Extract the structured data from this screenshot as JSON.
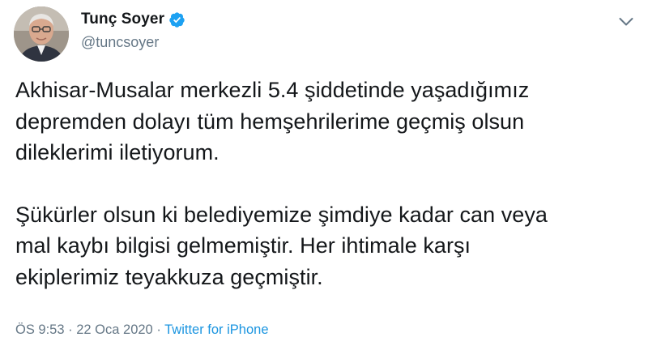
{
  "user": {
    "display_name": "Tunç Soyer",
    "handle": "@tuncsoyer",
    "avatar_icon": "profile-photo",
    "verified_icon": "verified-badge-icon"
  },
  "tweet": {
    "paragraphs": [
      [
        "Akhisar-Musalar merkezli 5.4 şiddetinde yaşadığımız",
        "depremden dolayı tüm hemşehrilerime geçmiş olsun",
        "dileklerimi iletiyorum."
      ],
      [
        "Şükürler olsun ki belediyemize şimdiye kadar can veya",
        "mal kaybı bilgisi gelmemiştir. Her ihtimale karşı",
        "ekiplerimiz teyakkuza geçmiştir."
      ]
    ],
    "time": "ÖS 9:53",
    "separator": "·",
    "date": "22 Oca 2020",
    "source": "Twitter for iPhone"
  },
  "colors": {
    "text": "#14171a",
    "secondary": "#657786",
    "accent": "#1b95e0"
  }
}
